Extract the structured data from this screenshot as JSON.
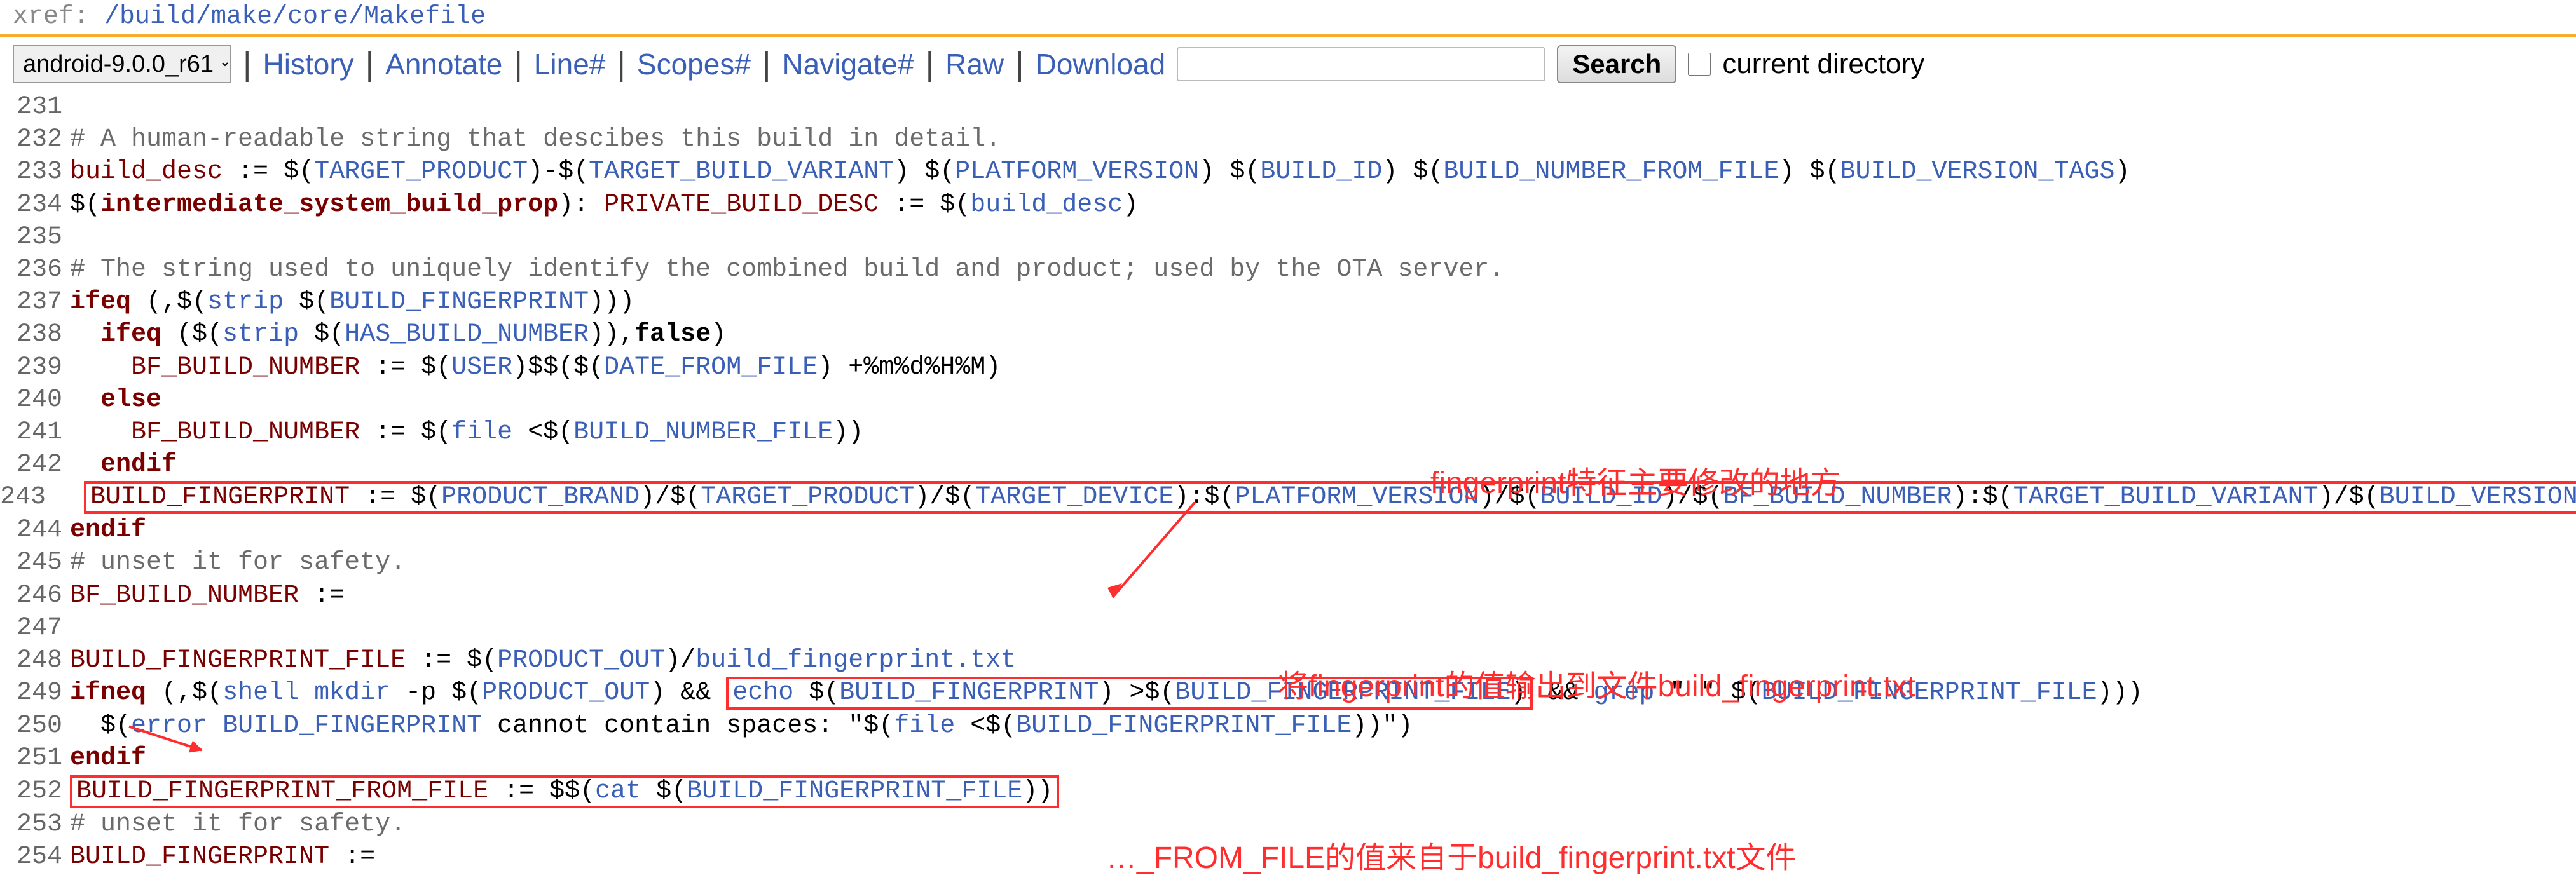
{
  "xref": {
    "label": "xref: ",
    "path": "/build/make/core/Makefile"
  },
  "branch": {
    "selected": "android-9.0.0_r61"
  },
  "nav": {
    "history": "History",
    "annotate": "Annotate",
    "line": "Line#",
    "scopes": "Scopes#",
    "navigate": "Navigate#",
    "raw": "Raw",
    "download": "Download"
  },
  "search": {
    "placeholder": "",
    "button": "Search",
    "current_dir": "current directory"
  },
  "lines": {
    "231": "",
    "232": "# A human-readable string that descibes this build in detail.",
    "233": "build_desc := $(TARGET_PRODUCT)-$(TARGET_BUILD_VARIANT) $(PLATFORM_VERSION) $(BUILD_ID) $(BUILD_NUMBER_FROM_FILE) $(BUILD_VERSION_TAGS)",
    "234": "$(intermediate_system_build_prop): PRIVATE_BUILD_DESC := $(build_desc)",
    "235": "",
    "236": "# The string used to uniquely identify the combined build and product; used by the OTA server.",
    "237": "ifeq (,$(strip $(BUILD_FINGERPRINT)))",
    "238": "  ifeq ($(strip $(HAS_BUILD_NUMBER)),false)",
    "239": "    BF_BUILD_NUMBER := $(USER)$$($(DATE_FROM_FILE) +%m%d%H%M)",
    "240": "  else",
    "241": "    BF_BUILD_NUMBER := $(file <$(BUILD_NUMBER_FILE))",
    "242": "  endif",
    "243": "  BUILD_FINGERPRINT := $(PRODUCT_BRAND)/$(TARGET_PRODUCT)/$(TARGET_DEVICE):$(PLATFORM_VERSION)/$(BUILD_ID)/$(BF_BUILD_NUMBER):$(TARGET_BUILD_VARIANT)/$(BUILD_VERSION_TAGS)",
    "244": "endif",
    "245": "# unset it for safety.",
    "246": "BF_BUILD_NUMBER :=",
    "247": "",
    "248": "BUILD_FINGERPRINT_FILE := $(PRODUCT_OUT)/build_fingerprint.txt",
    "249": "ifneq (,$(shell mkdir -p $(PRODUCT_OUT) && echo $(BUILD_FINGERPRINT) >$(BUILD_FINGERPRINT_FILE) && grep \" \" $(BUILD_FINGERPRINT_FILE)))",
    "250": "  $(error BUILD_FINGERPRINT cannot contain spaces: \"$(file <$(BUILD_FINGERPRINT_FILE))\")",
    "251": "endif",
    "252": "BUILD_FINGERPRINT_FROM_FILE := $$(cat $(BUILD_FINGERPRINT_FILE))",
    "253": "# unset it for safety.",
    "254": "BUILD_FINGERPRINT :="
  },
  "annotations": {
    "a1": "fingerprint特征主要修改的地方",
    "a2": "将fingerprint的值输出到文件build_fingerprint.txt",
    "a3": "…_FROM_FILE的值来自于build_fingerprint.txt文件"
  }
}
